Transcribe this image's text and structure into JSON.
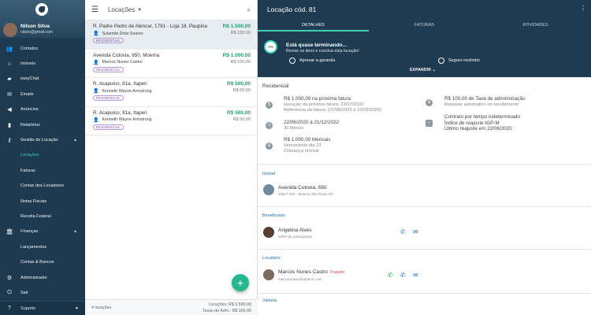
{
  "sidebar": {
    "user_name": "Nilson Silva",
    "user_email": "nilson@gmail.com",
    "items": [
      {
        "label": "Contatos",
        "icon": "contacts-icon",
        "glyph": "👥"
      },
      {
        "label": "Imóveis",
        "icon": "home-icon",
        "glyph": "⌂"
      },
      {
        "label": "easyChat",
        "icon": "chat-icon",
        "glyph": "💬"
      },
      {
        "label": "Emails",
        "icon": "mail-icon",
        "glyph": "✉"
      },
      {
        "label": "Anúncios",
        "icon": "megaphone-icon",
        "glyph": "📢"
      },
      {
        "label": "Relatórios",
        "icon": "chart-icon",
        "glyph": "▮"
      },
      {
        "label": "Gestão de Locação",
        "icon": "key-icon",
        "glyph": "⚷"
      }
    ],
    "sub_locacao": [
      "Locações",
      "Faturas",
      "Contas dos Locadores",
      "Notas Fiscais",
      "Receita Federal"
    ],
    "financas_label": "Finanças",
    "sub_financas": [
      "Lançamentos",
      "Contas & Bancos"
    ],
    "admin_label": "Administrador",
    "sair_label": "Sair",
    "suporte_label": "Suporte"
  },
  "list": {
    "title": "Locações",
    "cards": [
      {
        "address": "R. Padre Pedro de Alencar, 1791 - Loja 18, Paupina",
        "price": "R$ 1.500,00",
        "price2": "R$ 150,00",
        "tenant": "Sulamita Diniz Soares",
        "badge": "RESIDENCIAL"
      },
      {
        "address": "Avenida Cotovia, 650, Moema",
        "price": "R$ 1.000,00",
        "price2": "R$ 100,00",
        "tenant": "Marcos Nunes Castro",
        "badge": "RESIDENCIAL"
      },
      {
        "address": "R. Acapulco, 81a, Itaperi",
        "price": "R$ 500,00",
        "price2": "R$ 50,00",
        "tenant": "Kenneth Wayne Armstrong",
        "badge": "RESIDENCIAL"
      },
      {
        "address": "R. Acapulco, 81a, Itaperi",
        "price": "R$ 500,00",
        "price2": "R$ 50,00",
        "tenant": "Kenneth Wayne Armstrong",
        "badge": "RESIDENCIAL"
      }
    ],
    "count": "4 locações",
    "total_locacoes": "Locações: R$ 3.500,00",
    "total_taxa": "Taxas de Adm.: R$ 350,00"
  },
  "detail": {
    "title": "Locação cód. 81",
    "tabs": [
      "DETALHES",
      "FATURAS",
      "ATIVIDADES"
    ],
    "progress": "0%",
    "progress_title": "Está quase terminando...",
    "progress_sub": "Revise os itens e conclua esta locação!",
    "check1": "Aprovar a garantia",
    "check2": "Seguro incêndio",
    "expand": "EXPANDIR",
    "section": "Residencial",
    "info": {
      "fatura_main": "R$ 1.000,00 na próxima fatura",
      "fatura_l2": "Geração da próxima fatura: 23/07/2020",
      "fatura_l3": "Referência da fatura: (22/08/2020 à 21/09/2020)",
      "periodo_main": "22/06/2020 à 21/12/2022",
      "periodo_l2": "30 Meses",
      "mensal_main": "R$ 1.000,00 Mensais",
      "mensal_l2": "Vencimento dia 22",
      "mensal_l3": "Cobrança normal",
      "taxa_main": "R$ 100,00 de Taxa de administração",
      "taxa_l2": "Repasse automático no recebimento",
      "contrato_main": "Contrato por tempo indeterminado",
      "contrato_l2": "Índice de reajuste IGP-M",
      "contrato_l3": "Último reajuste em 22/06/2020"
    },
    "imovel_label": "Imóvel",
    "imovel_addr": "Avenida Cotovia, 650",
    "imovel_sub": "04517-001 - Moema São Paulo SP",
    "benef_label": "Beneficiário",
    "benef_name": "Angelina Alves",
    "benef_sub": "100% de participação",
    "locat_label": "Locatário",
    "locat_name": "Marcos Nunes Castro",
    "locat_tag": "Pagador",
    "locat_sub": "marcosnunes@ingeniz.com",
    "vistoria_label": "Vistoria"
  }
}
